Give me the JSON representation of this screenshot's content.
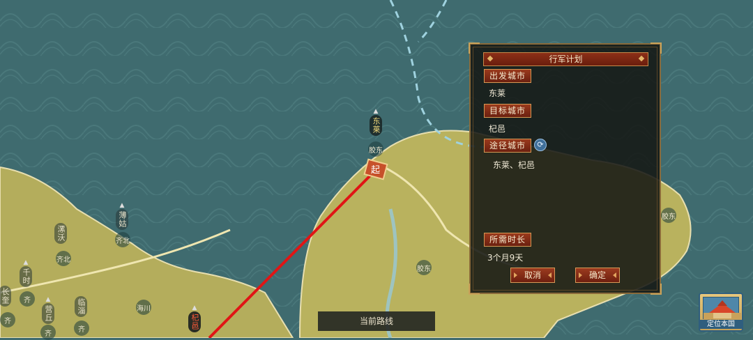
{
  "map": {
    "cities": [
      {
        "name": "东莱",
        "state": "origin"
      },
      {
        "name": "薄姑"
      },
      {
        "name": "漯沃"
      },
      {
        "name": "千时"
      },
      {
        "name": "长奎"
      },
      {
        "name": "营丘"
      },
      {
        "name": "临淄"
      },
      {
        "name": "杞邑",
        "state": "target"
      },
      {
        "name": "胶东"
      }
    ],
    "regions": [
      "胶东",
      "齐北",
      "齐北",
      "齐",
      "齐",
      "齐",
      "齐",
      "海川",
      "胶东",
      "胶东"
    ],
    "start_marker": "起",
    "colors": {
      "route": "#e01515",
      "sea": "#3f6b6f",
      "land": "#b9b25e"
    }
  },
  "plan_panel": {
    "title": "行军计划",
    "departure_label": "出发城市",
    "departure_value": "东莱",
    "target_label": "目标城市",
    "target_value": "杞邑",
    "via_label": "途径城市",
    "via_icon": "refresh-icon",
    "via_value": "东莱、杞邑",
    "time_label": "所需时长",
    "time_value": "3个月9天",
    "cancel_label": "取消",
    "confirm_label": "确定"
  },
  "route_tab": {
    "label": "当前路线"
  },
  "locate_button": {
    "label": "定位本国",
    "icon": "palace-icon"
  }
}
